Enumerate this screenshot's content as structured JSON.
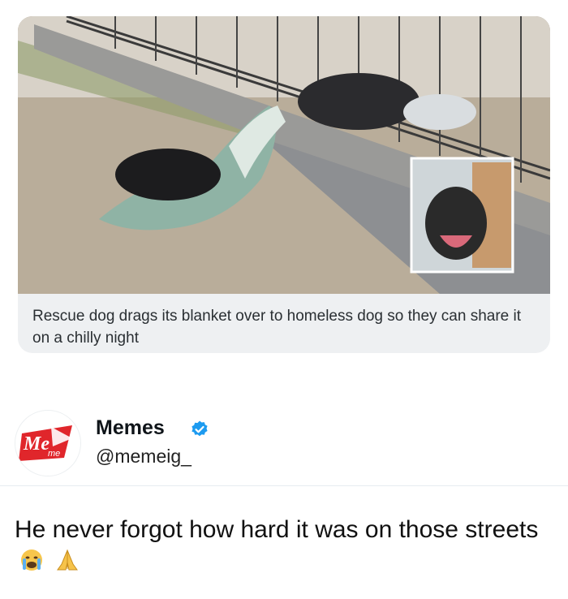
{
  "media": {
    "caption": "Rescue dog drags its blanket over to homeless dog so they can share it on a chilly night"
  },
  "author": {
    "display_name": "Memes",
    "handle": "@memeig_",
    "avatar_logo_text": "Meme",
    "verified": true
  },
  "tweet": {
    "text": "He never forgot how hard it was on those streets",
    "emojis": [
      "crying-face-icon",
      "folded-hands-icon"
    ]
  },
  "colors": {
    "verified_blue": "#1d9bf0",
    "logo_red": "#e0262b"
  }
}
